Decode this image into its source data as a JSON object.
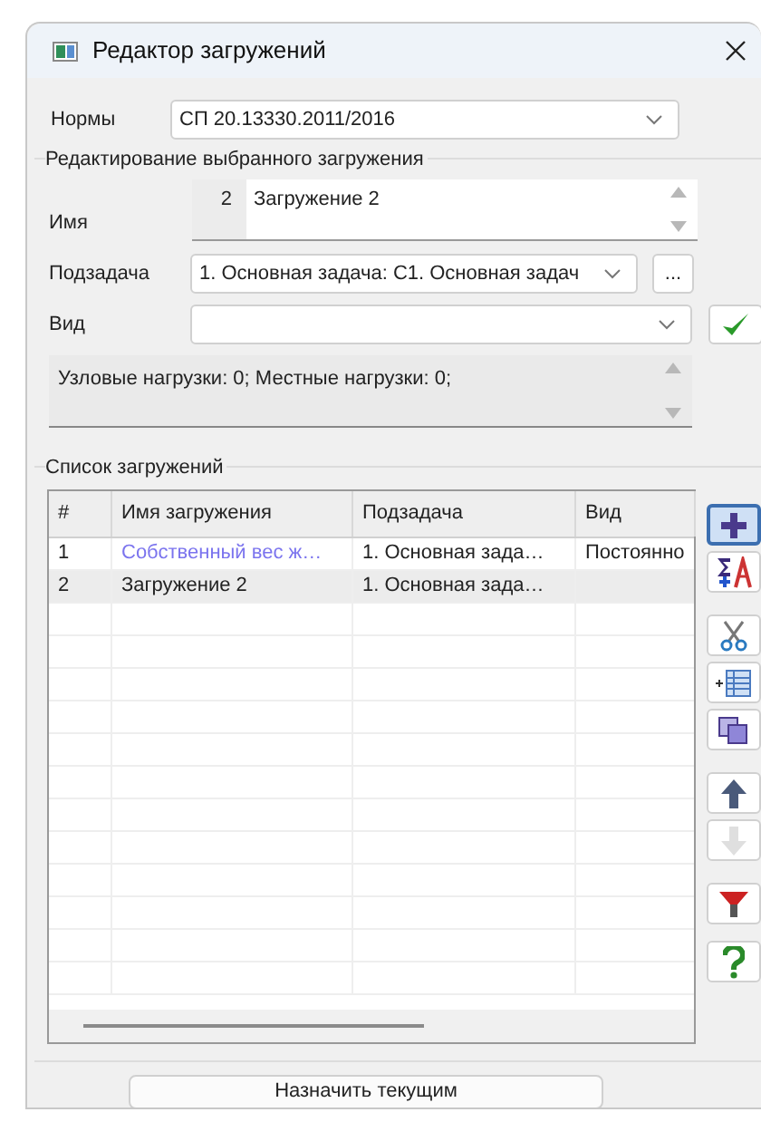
{
  "window": {
    "title": "Редактор загружений"
  },
  "norms": {
    "label": "Нормы",
    "value": "СП 20.13330.2011/2016"
  },
  "edit_group": {
    "title": "Редактирование выбранного загружения",
    "name": {
      "label": "Имя",
      "number": "2",
      "value": "Загружение 2"
    },
    "subtask": {
      "label": "Подзадача",
      "value": "1. Основная задача: С1. Основная задач",
      "more": "..."
    },
    "kind": {
      "label": "Вид"
    },
    "info": "Узловые нагрузки:  0;  Местные нагрузки:  0;"
  },
  "list_group": {
    "title": "Список загружений",
    "table": {
      "columns": [
        "#",
        "Имя загружения",
        "Подзадача",
        "Вид"
      ],
      "rows": [
        {
          "cells": [
            "1",
            "Собственный вес ж…",
            "1. Основная зада…",
            "Постоянно"
          ],
          "color": "#7b74ee",
          "selected": false
        },
        {
          "cells": [
            "2",
            "Загружение 2",
            "1. Основная зада…",
            ""
          ],
          "color": "#222222",
          "selected": true
        }
      ]
    },
    "tools": [
      {
        "kind": "add",
        "focused": true,
        "disabled": false
      },
      {
        "kind": "sum",
        "focused": false,
        "disabled": false
      },
      {
        "kind": "cut",
        "focused": false,
        "disabled": false
      },
      {
        "kind": "insert",
        "focused": false,
        "disabled": false
      },
      {
        "kind": "copy",
        "focused": false,
        "disabled": false
      },
      {
        "kind": "up",
        "focused": false,
        "disabled": false
      },
      {
        "kind": "down",
        "focused": false,
        "disabled": true
      },
      {
        "kind": "filter",
        "focused": false,
        "disabled": false
      },
      {
        "kind": "help",
        "focused": false,
        "disabled": false
      }
    ]
  },
  "assign_button": "Назначить текущим"
}
